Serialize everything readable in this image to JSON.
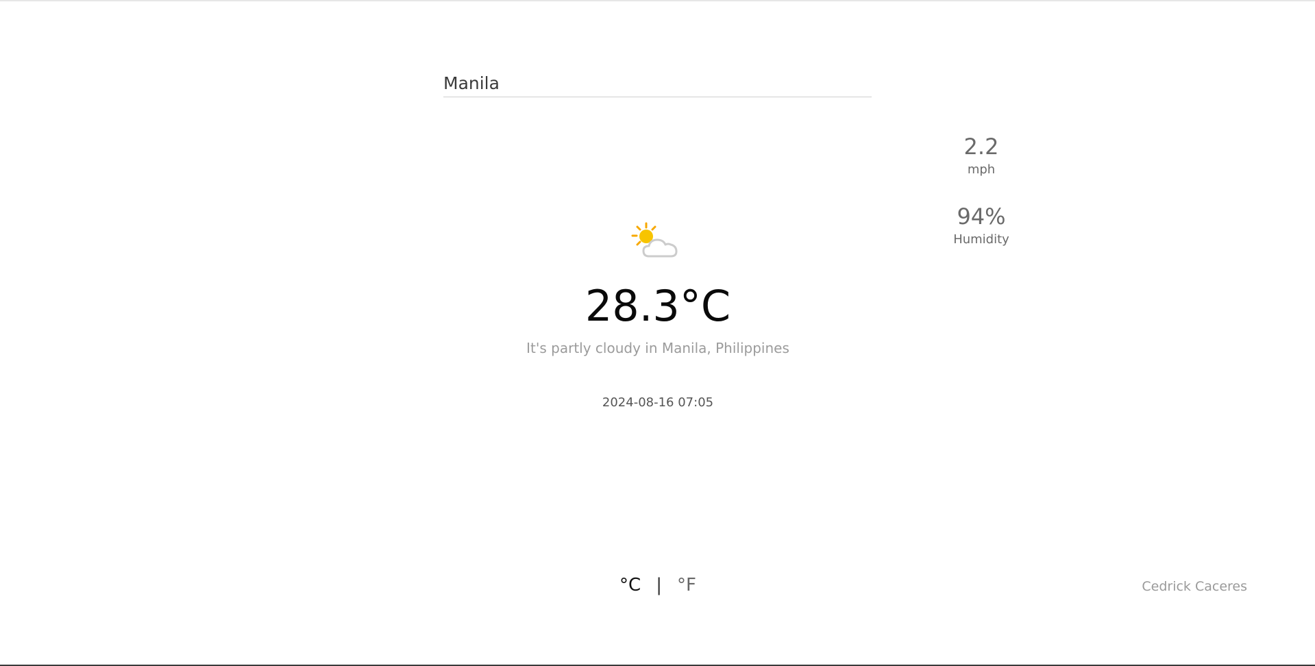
{
  "search": {
    "value": "Manila",
    "placeholder": ""
  },
  "stats": {
    "wind_value": "2.2",
    "wind_unit": "mph",
    "humidity_value": "94%",
    "humidity_label": "Humidity"
  },
  "weather": {
    "icon": "partly-cloudy-icon",
    "temperature": "28.3°C",
    "description": "It's partly cloudy in Manila, Philippines",
    "datetime": "2024-08-16 07:05"
  },
  "units": {
    "celsius": "°C",
    "separator": "|",
    "fahrenheit": "°F"
  },
  "footer": {
    "author": "Cedrick Caceres"
  },
  "colors": {
    "sun": "#f7c400",
    "cloud_stroke": "#cccccc"
  }
}
